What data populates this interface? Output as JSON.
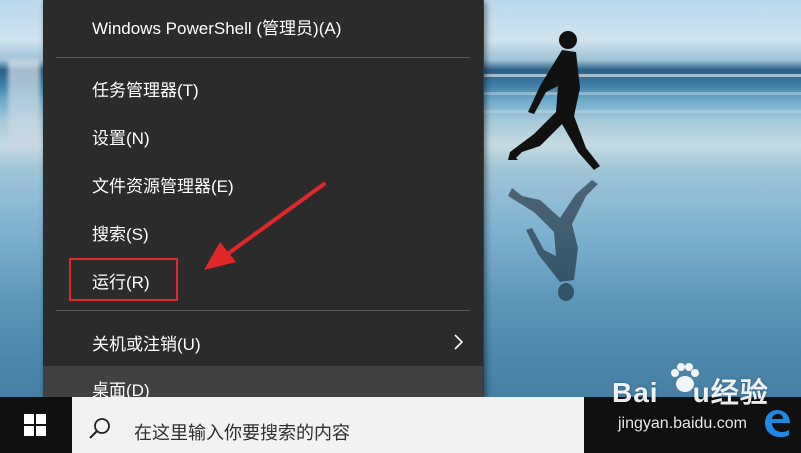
{
  "menu": {
    "items": [
      {
        "label": "Windows PowerShell (管理员)(A)"
      },
      {
        "label": "任务管理器(T)"
      },
      {
        "label": "设置(N)"
      },
      {
        "label": "文件资源管理器(E)"
      },
      {
        "label": "搜索(S)"
      },
      {
        "label": "运行(R)"
      },
      {
        "label": "关机或注销(U)"
      },
      {
        "label": "桌面(D)"
      }
    ],
    "highlighted_item": "运行(R)",
    "hovered_item": "桌面(D)"
  },
  "taskbar": {
    "search_placeholder": "在这里输入你要搜索的内容"
  },
  "watermark": {
    "brand": "Bai",
    "brand_suffix": "经验",
    "url": "jingyan.baidu.com"
  },
  "colors": {
    "menu_bg": "#2b2b2b",
    "hover_bg": "#414141",
    "annotation": "#e0282a",
    "taskbar_bg": "#101010",
    "edge_blue": "#1e88e5"
  },
  "icons": [
    "windows-logo-icon",
    "search-icon",
    "chevron-right-icon",
    "edge-browser-icon",
    "red-arrow-annotation"
  ]
}
